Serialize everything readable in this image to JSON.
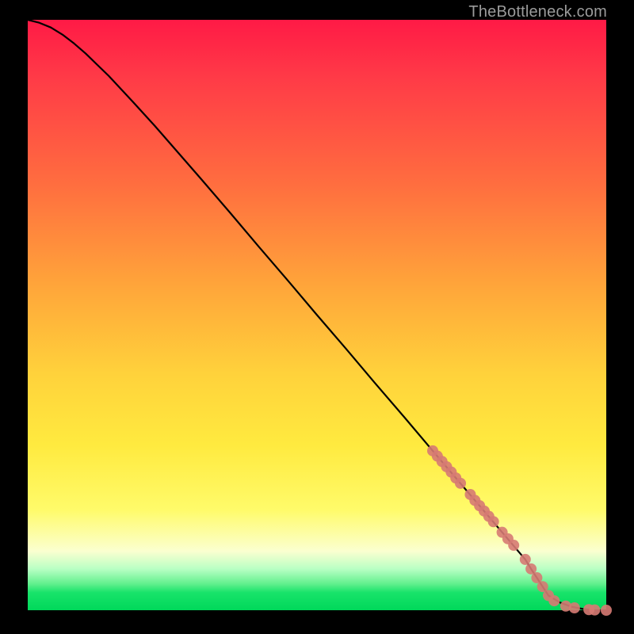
{
  "watermark": "TheBottleneck.com",
  "colors": {
    "curve": "#000000",
    "marker_fill": "#d67a73",
    "marker_stroke": "#d67a73",
    "gradient_top": "#ff1a46",
    "gradient_mid": "#ffea3f",
    "gradient_bottom": "#00d85a",
    "frame": "#000000"
  },
  "chart_data": {
    "type": "line",
    "title": "",
    "xlabel": "",
    "ylabel": "",
    "xlim": [
      0,
      100
    ],
    "ylim": [
      0,
      100
    ],
    "series": [
      {
        "name": "bottleneck-curve",
        "x": [
          0,
          2,
          4,
          6,
          8,
          10,
          14,
          18,
          22,
          26,
          30,
          35,
          40,
          45,
          50,
          55,
          60,
          65,
          70,
          72,
          74,
          76,
          78,
          80,
          82,
          84,
          86,
          87,
          88,
          89,
          90,
          92,
          94,
          96,
          98,
          100
        ],
        "y": [
          100,
          99.5,
          98.7,
          97.5,
          96.0,
          94.3,
          90.5,
          86.3,
          82.0,
          77.5,
          73.0,
          67.3,
          61.5,
          55.8,
          50.0,
          44.3,
          38.5,
          32.8,
          27.0,
          24.7,
          22.4,
          20.1,
          17.8,
          15.5,
          13.2,
          10.9,
          8.6,
          7.0,
          5.5,
          4.0,
          2.5,
          1.3,
          0.6,
          0.2,
          0.0,
          0.0
        ]
      }
    ],
    "markers": {
      "name": "highlighted-points",
      "x": [
        70.0,
        70.8,
        71.6,
        72.4,
        73.2,
        74.0,
        74.8,
        76.5,
        77.3,
        78.1,
        78.9,
        79.7,
        80.5,
        82.0,
        83.0,
        84.0,
        86.0,
        87.0,
        88.0,
        89.0,
        90.0,
        91.0,
        93.0,
        94.5,
        97.0,
        98.0,
        100.0
      ],
      "y": [
        27.0,
        26.1,
        25.2,
        24.3,
        23.4,
        22.4,
        21.5,
        19.6,
        18.6,
        17.7,
        16.8,
        15.9,
        15.0,
        13.2,
        12.1,
        11.0,
        8.6,
        7.0,
        5.5,
        4.0,
        2.5,
        1.6,
        0.7,
        0.4,
        0.1,
        0.05,
        0.0
      ]
    }
  }
}
